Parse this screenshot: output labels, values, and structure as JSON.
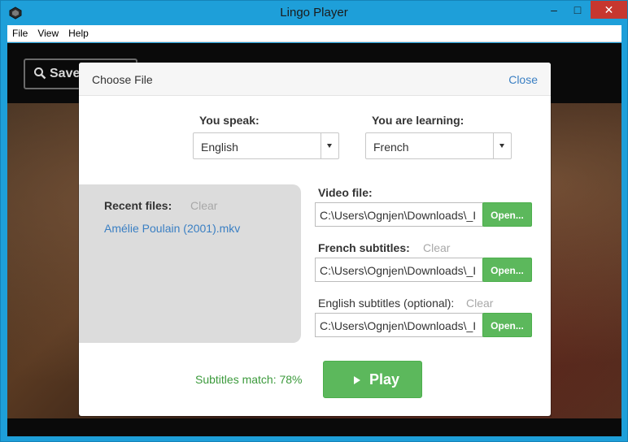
{
  "window": {
    "title": "Lingo Player",
    "controls": {
      "minimize": "–",
      "maximize": "□",
      "close": "✕"
    }
  },
  "menu": {
    "items": [
      "File",
      "View",
      "Help"
    ]
  },
  "background": {
    "save_button_label": "Save"
  },
  "dialog": {
    "title": "Choose File",
    "close_label": "Close",
    "you_speak": {
      "label": "You speak:",
      "selected": "English"
    },
    "you_are_learning": {
      "label": "You are learning:",
      "selected": "French"
    },
    "recent_files": {
      "label": "Recent files:",
      "clear_label": "Clear",
      "items": [
        "Amélie Poulain (2001).mkv"
      ]
    },
    "video_file": {
      "label": "Video file:",
      "value": "C:\\Users\\Ognjen\\Downloads\\_I",
      "open_label": "Open..."
    },
    "french_subtitles": {
      "label": "French subtitles:",
      "clear_label": "Clear",
      "value": "C:\\Users\\Ognjen\\Downloads\\_I",
      "open_label": "Open..."
    },
    "english_subtitles": {
      "label": "English subtitles (optional):",
      "clear_label": "Clear",
      "value": "C:\\Users\\Ognjen\\Downloads\\_I",
      "open_label": "Open..."
    },
    "subtitles_match": "Subtitles match: 78%",
    "play_label": "Play"
  },
  "colors": {
    "accent_blue": "#3a7fc3",
    "button_green": "#5cb85c",
    "match_green": "#3c9a3c",
    "titlebar_blue": "#1e9fd9"
  }
}
